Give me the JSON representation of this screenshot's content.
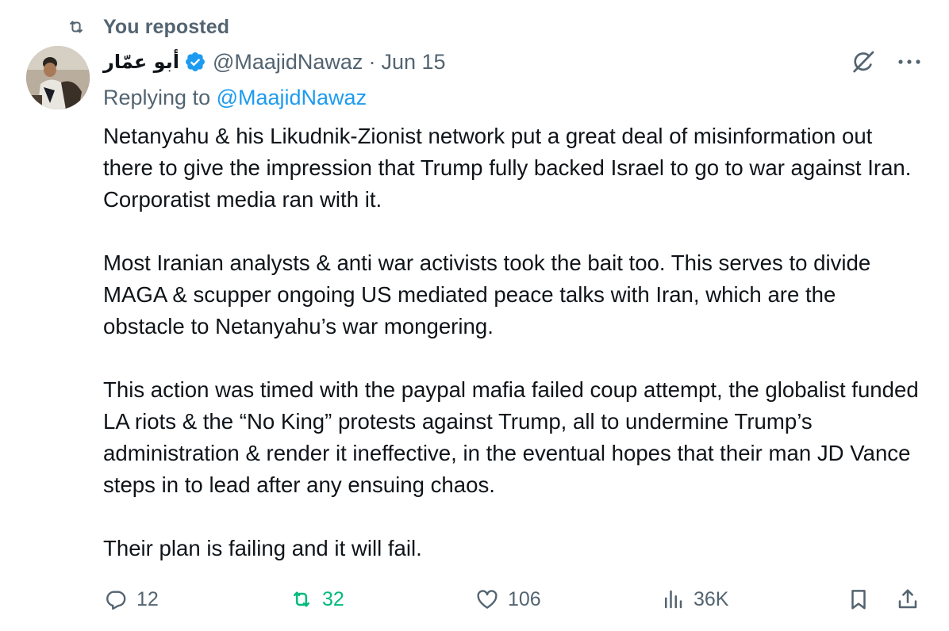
{
  "repost": {
    "label": "You reposted",
    "icon": "repost-icon"
  },
  "author": {
    "display_name": "أبو عمّار",
    "handle": "@MaajidNawaz",
    "separator": "·",
    "date": "Jun 15",
    "verified": true
  },
  "reply": {
    "prefix": "Replying to ",
    "handle": "@MaajidNawaz"
  },
  "body": {
    "paragraphs": [
      "Netanyahu & his Likudnik-Zionist network put a great deal of misinformation out there to give the impression that Trump fully backed Israel to go to war against Iran. Corporatist media ran with it.",
      "Most Iranian analysts & anti war activists took the bait too. This serves to divide MAGA & scupper ongoing US mediated peace talks with Iran, which are the obstacle to Netanyahu’s war mongering.",
      "This action was timed with the paypal mafia failed coup attempt, the globalist funded LA riots & the “No King” protests against Trump, all to undermine Trump’s administration & render it ineffective, in the eventual hopes that their man JD Vance steps in to lead after any ensuing chaos.",
      "Their plan is failing and it will fail."
    ]
  },
  "actions": {
    "replies": "12",
    "reposts": "32",
    "likes": "106",
    "views": "36K"
  },
  "colors": {
    "text": "#0f1419",
    "muted": "#536471",
    "link": "#1d9bf0",
    "repost_active": "#00ba7c",
    "verified": "#1d9bf0"
  }
}
